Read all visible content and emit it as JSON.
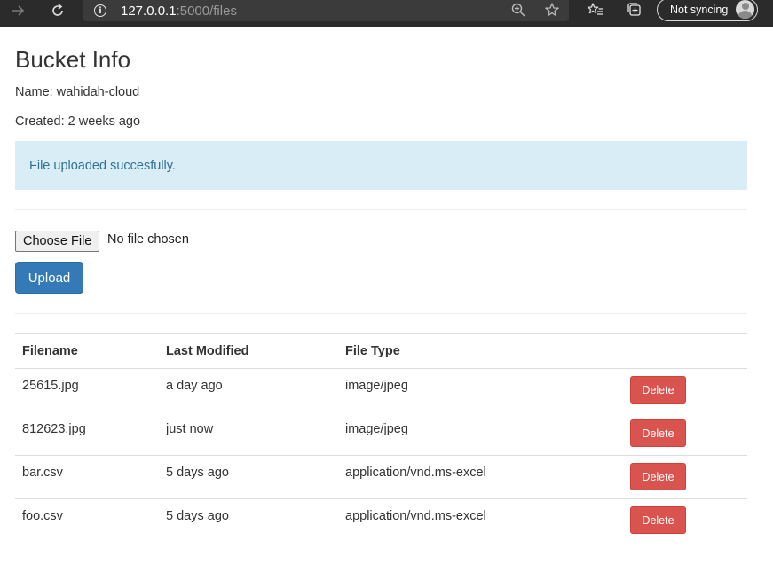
{
  "browser": {
    "url_host": "127.0.0.1",
    "url_rest": ":5000/files",
    "sync_label": "Not syncing"
  },
  "page": {
    "title": "Bucket Info",
    "name_line": "Name: wahidah-cloud",
    "created_line": "Created: 2 weeks ago",
    "alert": "File uploaded succesfully."
  },
  "upload": {
    "choose_label": "Choose File",
    "no_file_text": "No file chosen",
    "upload_label": "Upload"
  },
  "table": {
    "headers": [
      "Filename",
      "Last Modified",
      "File Type",
      ""
    ],
    "delete_label": "Delete",
    "rows": [
      {
        "filename": "25615.jpg",
        "modified": "a day ago",
        "type": "image/jpeg"
      },
      {
        "filename": "812623.jpg",
        "modified": "just now",
        "type": "image/jpeg"
      },
      {
        "filename": "bar.csv",
        "modified": "5 days ago",
        "type": "application/vnd.ms-excel"
      },
      {
        "filename": "foo.csv",
        "modified": "5 days ago",
        "type": "application/vnd.ms-excel"
      }
    ]
  },
  "colors": {
    "alert_bg": "#d9edf7",
    "primary": "#337ab7",
    "danger": "#d9534f"
  }
}
